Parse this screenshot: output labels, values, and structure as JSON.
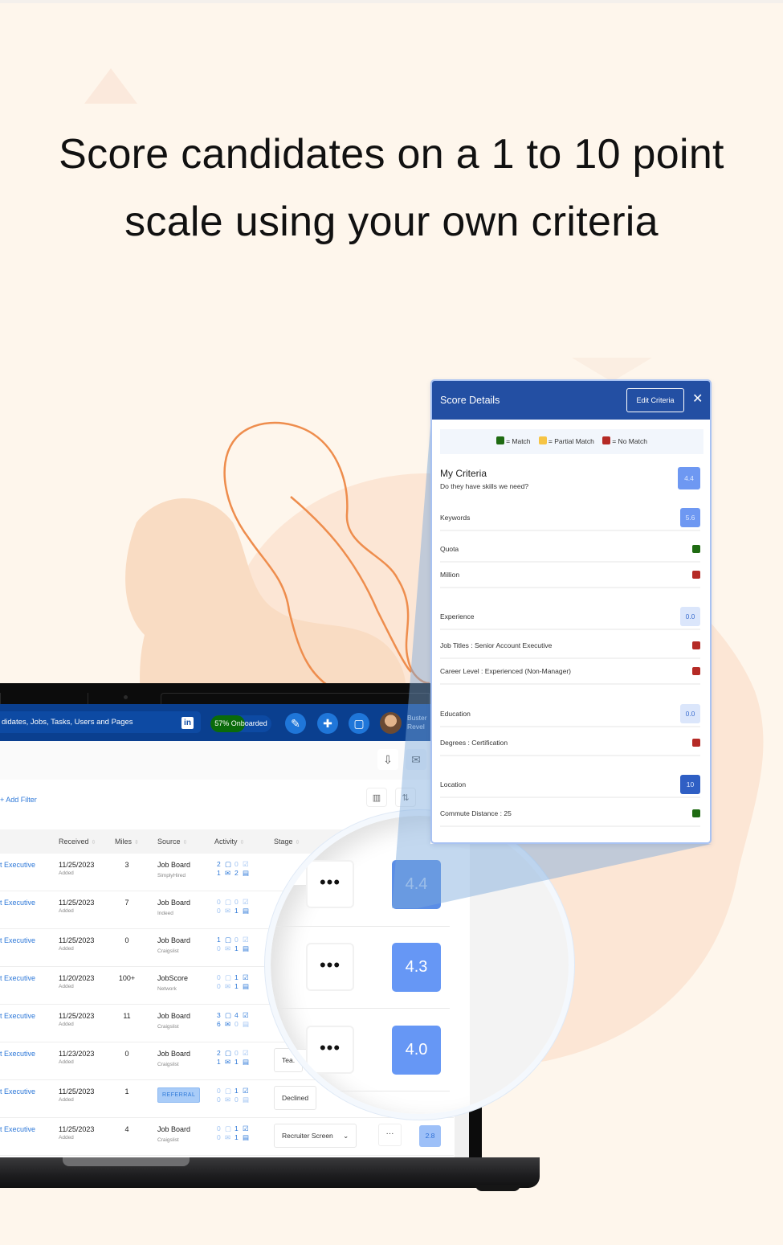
{
  "headline": "Score candidates on a 1 to 10 point scale using your own criteria",
  "colors": {
    "background": "#fef6ec",
    "header_blue": "#0a3f8f",
    "panel_header": "#234fa3",
    "match": "#1f6b12",
    "partial_match": "#f6c445",
    "no_match": "#b52a25",
    "score_blue": "#6697f5",
    "location_badge": "#2f5fc4",
    "zero_badge": "#dbe6fb"
  },
  "app_header": {
    "search_placeholder": "didates, Jobs, Tasks, Users and Pages",
    "linkedin_icon": "in",
    "onboarding": {
      "label": "57% Onboarded",
      "percent": 57
    },
    "buttons": [
      {
        "name": "brush-icon",
        "glyph": "✎"
      },
      {
        "name": "plus-icon",
        "glyph": "✚"
      },
      {
        "name": "chat-icon",
        "glyph": "▢"
      }
    ],
    "user": {
      "first": "Buster",
      "last": "Revel"
    }
  },
  "toolbar": {
    "download_icon": "⇩",
    "email_icon": "✉",
    "add_filter": "+ Add Filter",
    "columns_icon": "▥",
    "sort_icon": "⇅"
  },
  "table": {
    "columns": [
      "Received",
      "Miles",
      "Source",
      "Activity",
      "Stage"
    ],
    "sort_glyph": "⇳",
    "rows": [
      {
        "job": "t Executive",
        "date": "11/25/2023",
        "date_sub": "Added",
        "miles": "3",
        "source": "Job Board",
        "source_sub": "SimplyHired",
        "referral": false,
        "act": [
          "2",
          "0",
          "1",
          "2"
        ],
        "stage": "",
        "score": "4.4"
      },
      {
        "job": "t Executive",
        "date": "11/25/2023",
        "date_sub": "Added",
        "miles": "7",
        "source": "Job Board",
        "source_sub": "Indeed",
        "referral": false,
        "act": [
          "0",
          "0",
          "0",
          "1"
        ],
        "stage": "",
        "score": "4.3"
      },
      {
        "job": "t Executive",
        "date": "11/25/2023",
        "date_sub": "Added",
        "miles": "0",
        "source": "Job Board",
        "source_sub": "Craigslist",
        "referral": false,
        "act": [
          "1",
          "0",
          "0",
          "1"
        ],
        "stage": "",
        "score": ""
      },
      {
        "job": "t Executive",
        "date": "11/20/2023",
        "date_sub": "Added",
        "miles": "100+",
        "source": "JobScore",
        "source_sub": "Network",
        "referral": false,
        "act": [
          "0",
          "1",
          "0",
          "1"
        ],
        "stage": "",
        "score": ""
      },
      {
        "job": "t Executive",
        "date": "11/25/2023",
        "date_sub": "Added",
        "miles": "11",
        "source": "Job Board",
        "source_sub": "Craigslist",
        "referral": false,
        "act": [
          "3",
          "4",
          "6",
          "0"
        ],
        "stage": "",
        "score": ""
      },
      {
        "job": "t Executive",
        "date": "11/23/2023",
        "date_sub": "Added",
        "miles": "0",
        "source": "Job Board",
        "source_sub": "Craigslist",
        "referral": false,
        "act": [
          "2",
          "0",
          "1",
          "1"
        ],
        "stage": "Tea.",
        "score": "4.0"
      },
      {
        "job": "t Executive",
        "date": "11/25/2023",
        "date_sub": "Added",
        "miles": "1",
        "source": "REFERRAL",
        "source_sub": "",
        "referral": true,
        "act": [
          "0",
          "1",
          "0",
          "0"
        ],
        "stage": "Declined",
        "score": ""
      },
      {
        "job": "t Executive",
        "date": "11/25/2023",
        "date_sub": "Added",
        "miles": "4",
        "source": "Job Board",
        "source_sub": "Craigslist",
        "referral": false,
        "act": [
          "0",
          "1",
          "0",
          "1"
        ],
        "stage": "Recruiter Screen",
        "score": "2.8"
      }
    ]
  },
  "magnifier": {
    "more_label": "•••",
    "scores": [
      "4.4",
      "4.3",
      "4.0"
    ],
    "stage_stubs": [
      "D",
      "Tea."
    ]
  },
  "score_details": {
    "title": "Score Details",
    "edit_button": "Edit Criteria",
    "close_icon": "✕",
    "legend": [
      {
        "label": "= Match",
        "color": "#1f6b12"
      },
      {
        "label": "= Partial Match",
        "color": "#f6c445"
      },
      {
        "label": "= No Match",
        "color": "#b52a25"
      }
    ],
    "criteria": {
      "title": "My Criteria",
      "subtitle": "Do they have skills we need?",
      "score": "4.4"
    },
    "rows": [
      {
        "label": "Keywords",
        "kind": "badge",
        "value": "5.6",
        "style": "mid"
      },
      {
        "label": "Quota",
        "kind": "dot",
        "status": "match"
      },
      {
        "label": "Million",
        "kind": "dot",
        "status": "no_match"
      },
      {
        "label": "Experience",
        "kind": "badge",
        "value": "0.0",
        "style": "zero"
      },
      {
        "label": "Job Titles : Senior Account Executive",
        "kind": "dot",
        "status": "no_match"
      },
      {
        "label": "Career Level : Experienced (Non-Manager)",
        "kind": "dot",
        "status": "no_match"
      },
      {
        "label": "Education",
        "kind": "badge",
        "value": "0.0",
        "style": "zero"
      },
      {
        "label": "Degrees : Certification",
        "kind": "dot",
        "status": "no_match"
      },
      {
        "label": "Location",
        "kind": "badge",
        "value": "10",
        "style": "high"
      },
      {
        "label": "Commute Distance : 25",
        "kind": "dot",
        "status": "match"
      }
    ]
  }
}
